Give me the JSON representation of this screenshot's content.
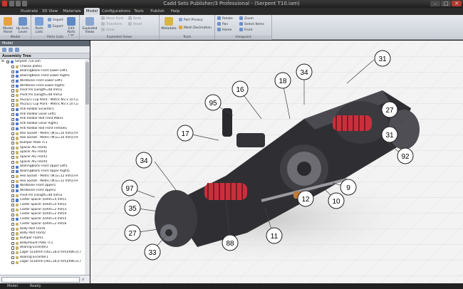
{
  "window": {
    "title": "Cadd Sets Publisher/3 Professional - (Serpent T10.iam)",
    "minimize": "–",
    "maximize": "□",
    "close": "✕"
  },
  "tabs": [
    {
      "label": "Illustrate",
      "active": false
    },
    {
      "label": "3D View",
      "active": false
    },
    {
      "label": "Materials",
      "active": false
    },
    {
      "label": "Model",
      "active": true
    },
    {
      "label": "Configurations",
      "active": false
    },
    {
      "label": "Tools",
      "active": false
    },
    {
      "label": "Publish",
      "active": false
    },
    {
      "label": "Help",
      "active": false
    }
  ],
  "ribbon": {
    "groups": [
      {
        "label": "Model"
      },
      {
        "label": "Parts Lists"
      },
      {
        "label": "Exploded Views"
      },
      {
        "label": "Tools"
      },
      {
        "label": "Viewpoint"
      }
    ],
    "model_panel": "Model Panel",
    "up_assembly": "Up Asm. Level",
    "parts_lists": "Parts Lists",
    "import": "Import",
    "export": "Export",
    "edit_parts_list": "Edit Parts List",
    "exploded_views": "Exploded Views",
    "move_parts": "Move Parts",
    "transform": "Transform",
    "undo": "Undo",
    "redo": "Redo",
    "reset": "Reset",
    "metadata": "Metadata",
    "part_privacy": "Part Privacy",
    "mesh_decimation": "Mesh Decimation",
    "rotate": "Rotate",
    "pan": "Pan",
    "home": "Home",
    "zoom": "Zoom",
    "select_items": "Select Items",
    "front": "Front"
  },
  "left_panel": {
    "header": "Model",
    "subheader": "Assembly Tree",
    "root": "Serpent 710.iam",
    "items": [
      {
        "label": "Chassis plate1",
        "checked": false,
        "blue": false
      },
      {
        "label": "Bearingblock Front Lower Left1",
        "checked": true,
        "blue": true
      },
      {
        "label": "Bearingblock Front Lower Right1",
        "checked": true,
        "blue": true
      },
      {
        "label": "Wishbone Front Lower Left1",
        "checked": true,
        "blue": true
      },
      {
        "label": "Wishbone Front Lower Right1",
        "checked": true,
        "blue": true
      },
      {
        "label": "Pivot Pin (Length=48 mm)1",
        "checked": false,
        "blue": false
      },
      {
        "label": "Pivot Pin (Length=48 mm)2",
        "checked": false,
        "blue": false
      },
      {
        "label": "AS1421 Cup Point - Metric M3 x 10 Cu",
        "checked": false,
        "blue": false
      },
      {
        "label": "AS1421 Cup Point - Metric M3 x 10 Cu",
        "checked": false,
        "blue": false
      },
      {
        "label": "Anti Rollbar Eccenter1",
        "checked": true,
        "blue": true
      },
      {
        "label": "Anti Rollbar Lever Left1",
        "checked": true,
        "blue": true
      },
      {
        "label": "Anti Rollbar Rod Front Male1",
        "checked": true,
        "blue": true
      },
      {
        "label": "Anti Rollbar Lever Right1",
        "checked": true,
        "blue": true
      },
      {
        "label": "Anti Rollbar Rod Front Female1",
        "checked": true,
        "blue": true
      },
      {
        "label": "Hex Socket - Metric (M,G=10 mm)[TH",
        "checked": false,
        "blue": false
      },
      {
        "label": "Hex Socket - Metric (M,G=10 mm)[TH",
        "checked": false,
        "blue": false
      },
      {
        "label": "Bumper Plate TC1",
        "checked": false,
        "blue": false
      },
      {
        "label": "Spacer Alu Front1",
        "checked": false,
        "blue": false
      },
      {
        "label": "Spacer Alu Front2",
        "checked": false,
        "blue": false
      },
      {
        "label": "Spacer Alu Front3",
        "checked": false,
        "blue": false
      },
      {
        "label": "Spacer Alu Front4",
        "checked": false,
        "blue": false
      },
      {
        "label": "Bearingblock Front Upper Left1",
        "checked": true,
        "blue": true
      },
      {
        "label": "Bearingblock Front Upper Right1",
        "checked": true,
        "blue": true
      },
      {
        "label": "Hex Socket - Metric (M,G=12 mm)[TH",
        "checked": false,
        "blue": false
      },
      {
        "label": "Hex Socket - Metric (M,G=12 mm)[TH",
        "checked": false,
        "blue": false
      },
      {
        "label": "Wishbone Front Upper1",
        "checked": true,
        "blue": true
      },
      {
        "label": "Wishbone Front Upper2",
        "checked": true,
        "blue": true
      },
      {
        "label": "Pivot Pin (Length=48 mm)3",
        "checked": false,
        "blue": false
      },
      {
        "label": "Caster Spacer (DiAm=4 mm)1",
        "checked": true,
        "blue": true
      },
      {
        "label": "Caster Spacer (DiAm=4 mm)2",
        "checked": false,
        "blue": false
      },
      {
        "label": "Caster Spacer (DiAm=2 mm)3",
        "checked": false,
        "blue": false
      },
      {
        "label": "Caster Spacer (DiAm=2 mm)4",
        "checked": false,
        "blue": false
      },
      {
        "label": "Caster Spacer (DiAm=4 mm)5",
        "checked": true,
        "blue": true
      },
      {
        "label": "Caster Spacer (DiAm=2 mm)6",
        "checked": false,
        "blue": false
      },
      {
        "label": "Body Post Front1",
        "checked": false,
        "blue": false
      },
      {
        "label": "Body Post Front2",
        "checked": false,
        "blue": false
      },
      {
        "label": "Bumper Foam1",
        "checked": false,
        "blue": false
      },
      {
        "label": "Bodymount Plate TC1",
        "checked": false,
        "blue": false
      },
      {
        "label": "Bearing Eccenter2",
        "checked": false,
        "blue": false
      },
      {
        "label": "Lager 5x10mm [OD=18,0 mm][RW=0,7",
        "checked": false,
        "blue": false
      },
      {
        "label": "Bearing Eccenter1",
        "checked": false,
        "blue": false
      },
      {
        "label": "Lager 5x10mm [OD=18,0 mm][RW=0,7",
        "checked": false,
        "blue": false
      }
    ]
  },
  "callouts": [
    "31",
    "34",
    "18",
    "16",
    "95",
    "27",
    "31",
    "92",
    "17",
    "34",
    "97",
    "35",
    "27",
    "33",
    "88",
    "11",
    "12",
    "10",
    "9"
  ],
  "status": {
    "model": "Model",
    "ready": "Ready"
  }
}
